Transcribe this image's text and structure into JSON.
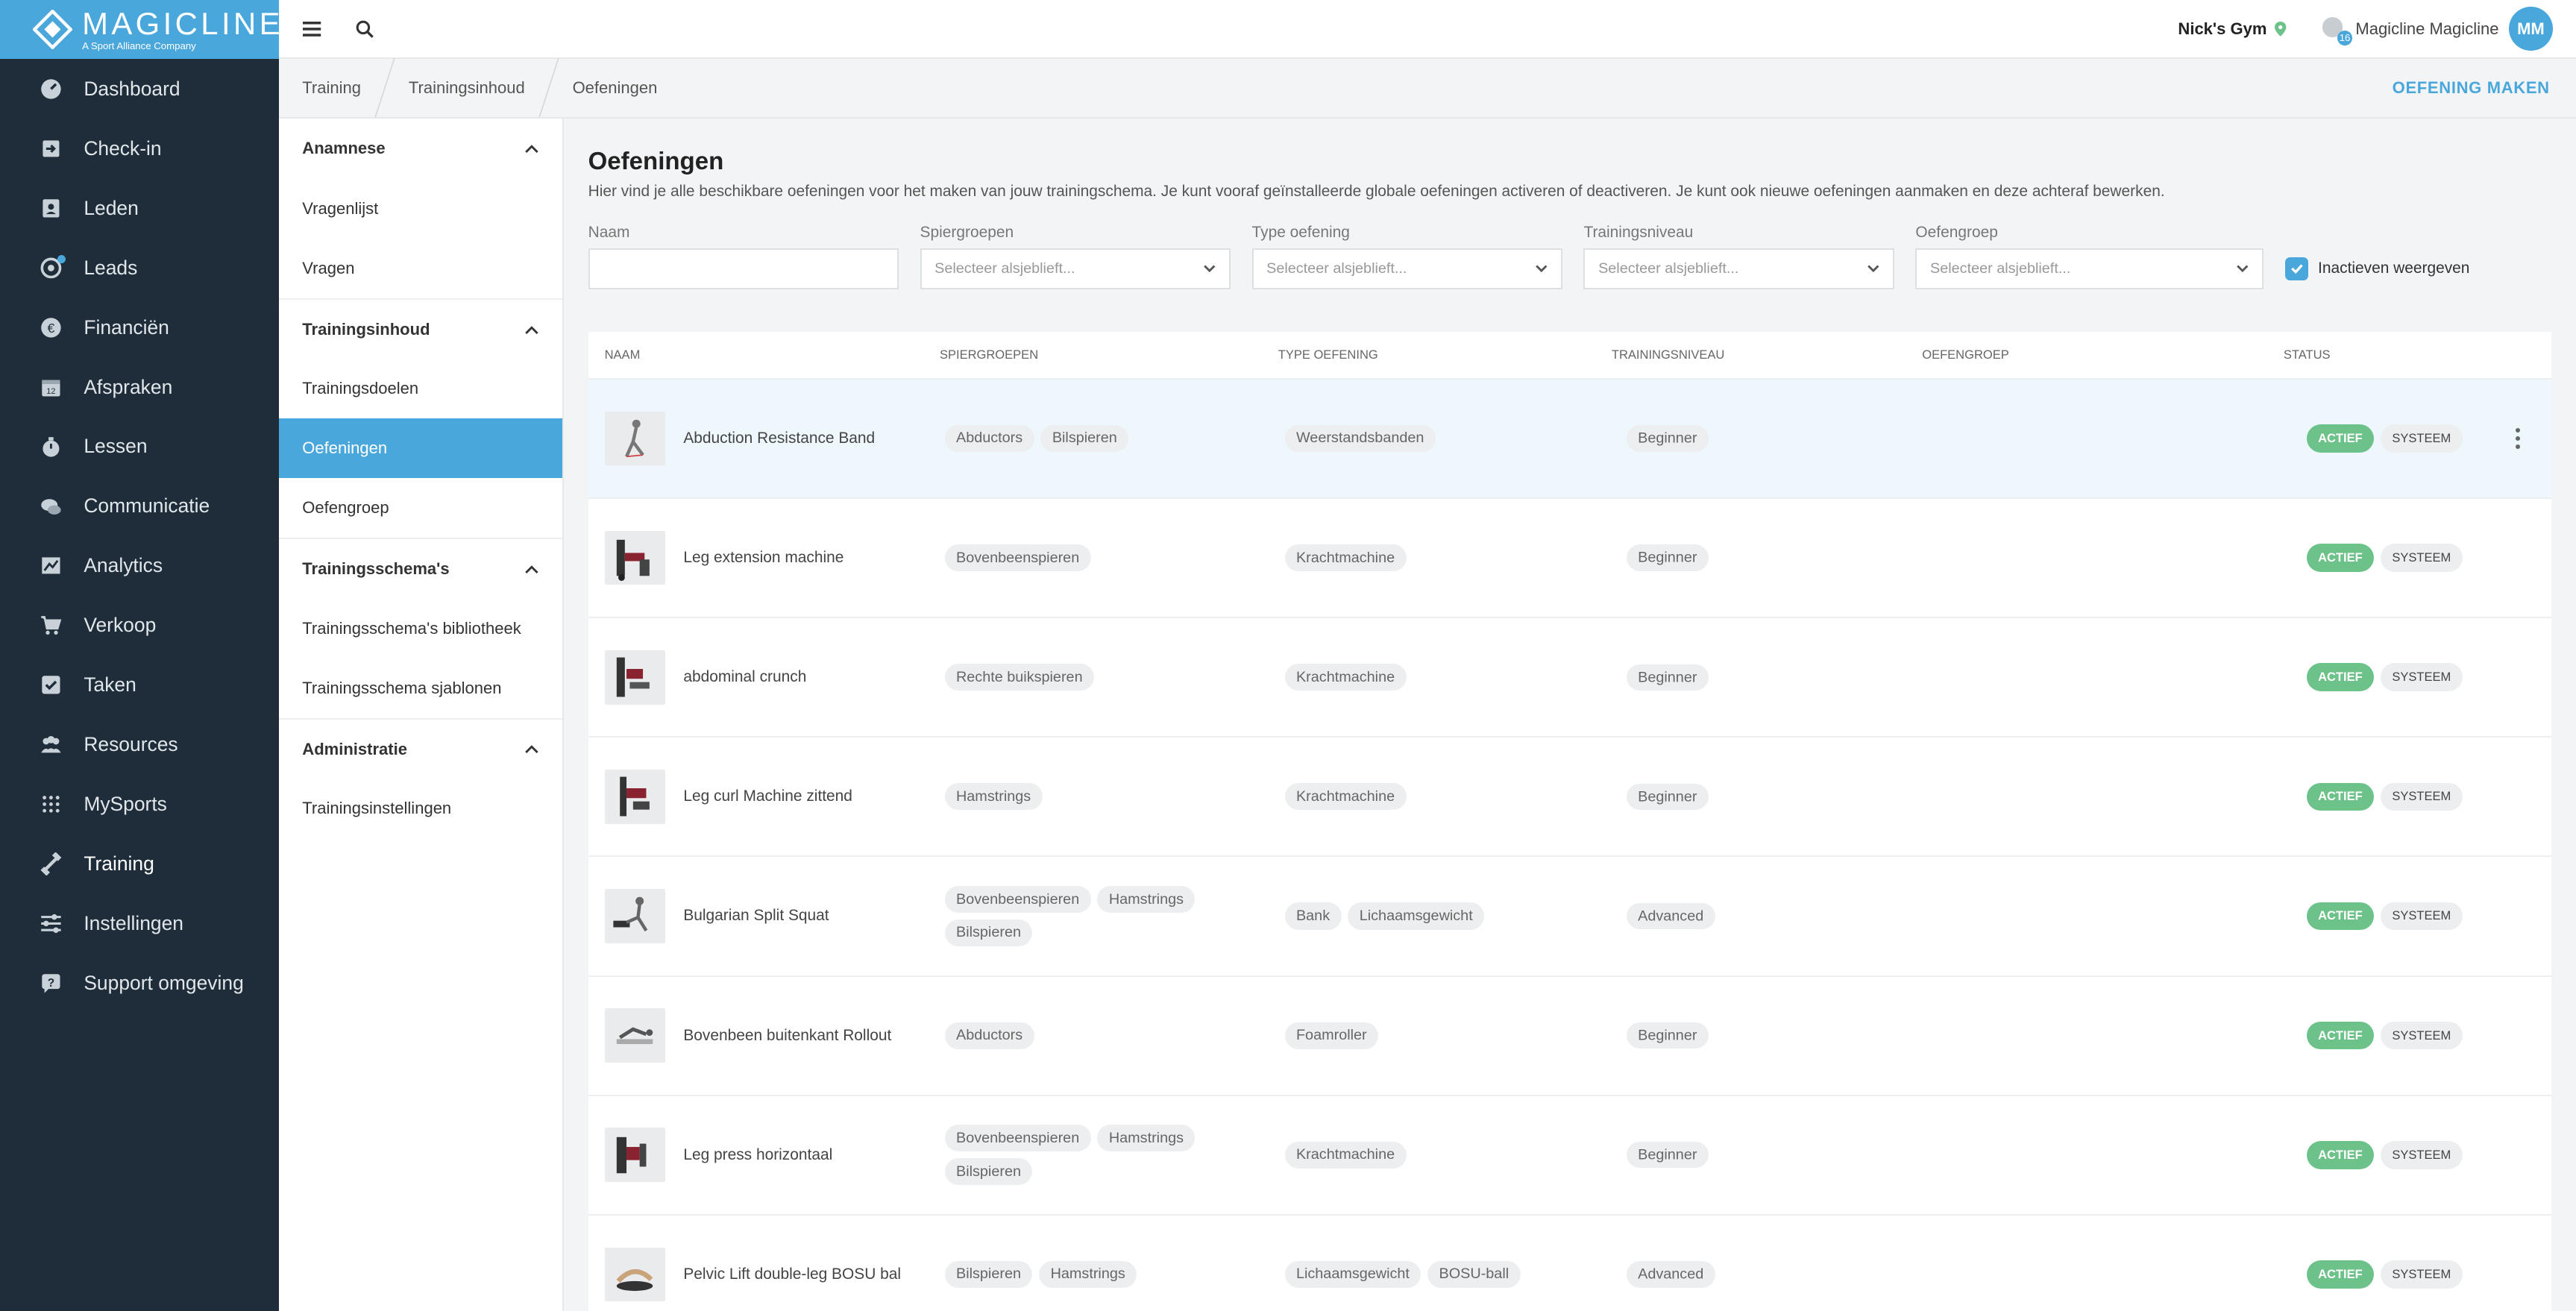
{
  "brand": {
    "name": "MAGICLINE",
    "tagline": "A Sport Alliance Company"
  },
  "nav": {
    "items": [
      {
        "label": "Dashboard",
        "icon": "dashboard-icon"
      },
      {
        "label": "Check-in",
        "icon": "check-in-icon"
      },
      {
        "label": "Leden",
        "icon": "members-icon"
      },
      {
        "label": "Leads",
        "icon": "leads-icon"
      },
      {
        "label": "Financiën",
        "icon": "finance-icon"
      },
      {
        "label": "Afspraken",
        "icon": "calendar-icon"
      },
      {
        "label": "Lessen",
        "icon": "classes-icon"
      },
      {
        "label": "Communicatie",
        "icon": "chat-icon"
      },
      {
        "label": "Analytics",
        "icon": "analytics-icon"
      },
      {
        "label": "Verkoop",
        "icon": "cart-icon"
      },
      {
        "label": "Taken",
        "icon": "tasks-icon"
      },
      {
        "label": "Resources",
        "icon": "resources-icon"
      },
      {
        "label": "MySports",
        "icon": "mysports-icon"
      },
      {
        "label": "Training",
        "icon": "training-icon"
      },
      {
        "label": "Instellingen",
        "icon": "settings-icon"
      },
      {
        "label": "Support omgeving",
        "icon": "support-icon"
      }
    ]
  },
  "topbar": {
    "gym": "Nick's Gym",
    "user_name": "Magicline Magicline",
    "notification_count": "16",
    "avatar_initials": "MM"
  },
  "breadcrumb": [
    "Training",
    "Trainingsinhoud",
    "Oefeningen"
  ],
  "header_action": "OEFENING MAKEN",
  "subnav": {
    "sections": [
      {
        "title": "Anamnese",
        "items": [
          "Vragenlijst",
          "Vragen"
        ]
      },
      {
        "title": "Trainingsinhoud",
        "items": [
          "Trainingsdoelen",
          "Oefeningen",
          "Oefengroep"
        ]
      },
      {
        "title": "Trainingsschema's",
        "items": [
          "Trainingsschema's bibliotheek",
          "Trainingsschema sjablonen"
        ]
      },
      {
        "title": "Administratie",
        "items": [
          "Trainingsinstellingen"
        ]
      }
    ],
    "active": "Oefeningen"
  },
  "page": {
    "title": "Oefeningen",
    "description": "Hier vind je alle beschikbare oefeningen voor het maken van jouw trainingschema. Je kunt vooraf geïnstalleerde globale oefeningen activeren of deactiveren. Je kunt ook nieuwe oefeningen aanmaken en deze achteraf bewerken."
  },
  "filters": {
    "name_label": "Naam",
    "name_value": "",
    "muscle_label": "Spiergroepen",
    "type_label": "Type oefening",
    "level_label": "Trainingsniveau",
    "group_label": "Oefengroep",
    "placeholder": "Selecteer alsjeblieft...",
    "show_inactive": "Inactieven weergeven"
  },
  "table": {
    "headers": {
      "name": "NAAM",
      "muscles": "SPIERGROEPEN",
      "type": "TYPE OEFENING",
      "level": "TRAININGSNIVEAU",
      "group": "OEFENGROEP",
      "status": "STATUS"
    },
    "status_active": "ACTIEF",
    "status_system": "SYSTEEM",
    "rows": [
      {
        "name": "Abduction Resistance Band",
        "muscles": [
          "Abductors",
          "Bilspieren"
        ],
        "types": [
          "Weerstandsbanden"
        ],
        "level": "Beginner"
      },
      {
        "name": "Leg extension machine",
        "muscles": [
          "Bovenbeenspieren"
        ],
        "types": [
          "Krachtmachine"
        ],
        "level": "Beginner"
      },
      {
        "name": "abdominal crunch",
        "muscles": [
          "Rechte buikspieren"
        ],
        "types": [
          "Krachtmachine"
        ],
        "level": "Beginner"
      },
      {
        "name": "Leg curl Machine zittend",
        "muscles": [
          "Hamstrings"
        ],
        "types": [
          "Krachtmachine"
        ],
        "level": "Beginner"
      },
      {
        "name": "Bulgarian Split Squat",
        "muscles": [
          "Bovenbeenspieren",
          "Hamstrings",
          "Bilspieren"
        ],
        "types": [
          "Bank",
          "Lichaamsgewicht"
        ],
        "level": "Advanced"
      },
      {
        "name": "Bovenbeen buitenkant Rollout",
        "muscles": [
          "Abductors"
        ],
        "types": [
          "Foamroller"
        ],
        "level": "Beginner"
      },
      {
        "name": "Leg press horizontaal",
        "muscles": [
          "Bovenbeenspieren",
          "Hamstrings",
          "Bilspieren"
        ],
        "types": [
          "Krachtmachine"
        ],
        "level": "Beginner"
      },
      {
        "name": "Pelvic Lift double-leg BOSU bal",
        "muscles": [
          "Bilspieren",
          "Hamstrings"
        ],
        "types": [
          "Lichaamsgewicht",
          "BOSU-ball"
        ],
        "level": "Advanced"
      }
    ]
  }
}
